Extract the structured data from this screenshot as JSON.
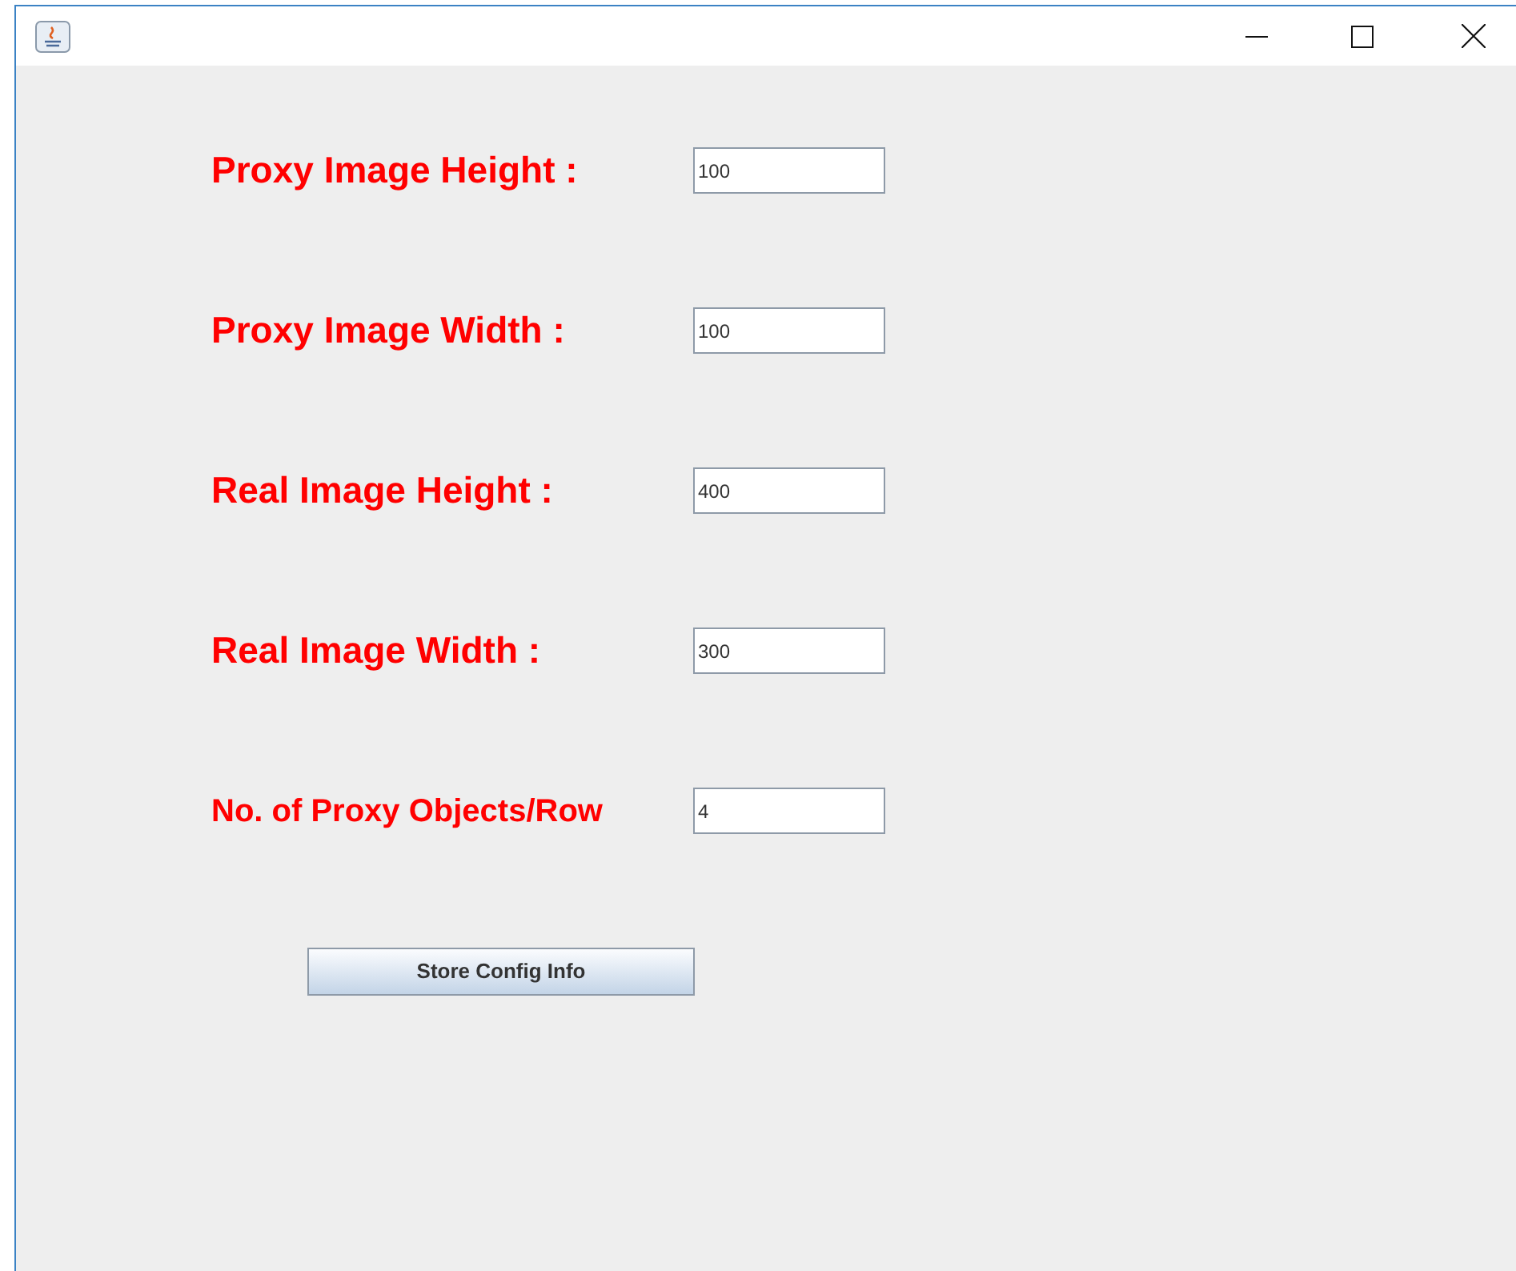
{
  "fields": [
    {
      "label": "Proxy Image Height :",
      "value": "100"
    },
    {
      "label": "Proxy Image Width :",
      "value": "100"
    },
    {
      "label": "Real Image Height :",
      "value": "400"
    },
    {
      "label": "Real Image Width :",
      "value": "300"
    },
    {
      "label": "No. of Proxy Objects/Row",
      "value": "4"
    }
  ],
  "button": "Store Config Info"
}
